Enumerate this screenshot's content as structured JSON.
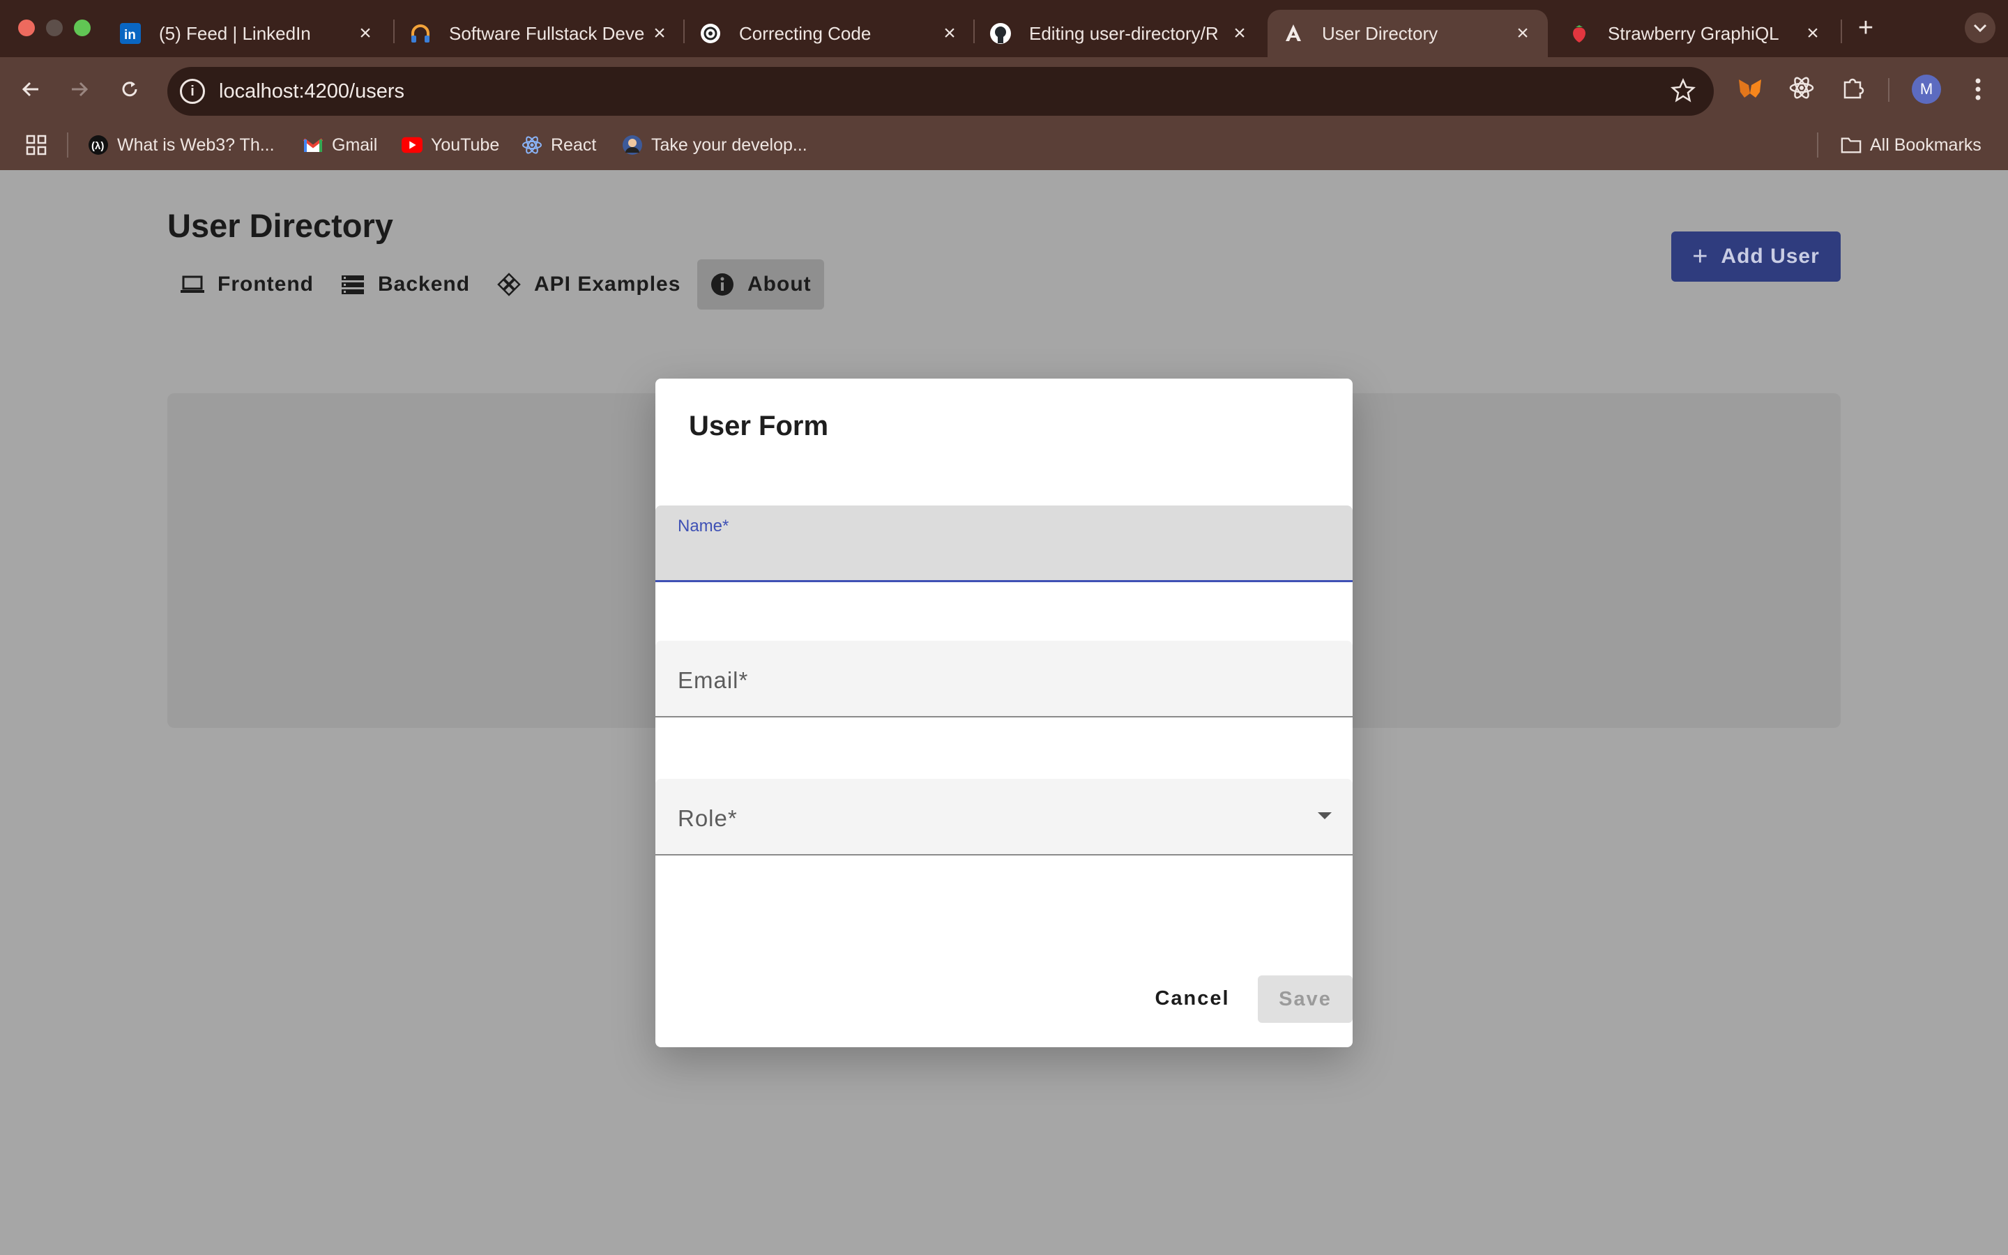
{
  "browser": {
    "tabs": [
      {
        "title": "(5) Feed | LinkedIn",
        "icon": "linkedin-icon"
      },
      {
        "title": "Software Fullstack Deve",
        "icon": "headphones-icon"
      },
      {
        "title": "Correcting Code",
        "icon": "openai-icon"
      },
      {
        "title": "Editing user-directory/R",
        "icon": "github-icon"
      },
      {
        "title": "User Directory",
        "icon": "angular-icon",
        "active": true
      },
      {
        "title": "Strawberry GraphiQL",
        "icon": "strawberry-icon"
      }
    ],
    "new_tab": "+",
    "url": "localhost:4200/users",
    "avatar_letter": "M",
    "bookmarks": [
      {
        "label": "What is Web3? Th...",
        "icon": "web3-icon"
      },
      {
        "label": "Gmail",
        "icon": "gmail-icon"
      },
      {
        "label": "YouTube",
        "icon": "youtube-icon"
      },
      {
        "label": "React",
        "icon": "react-icon"
      },
      {
        "label": "Take your develop...",
        "icon": "profile-icon"
      }
    ],
    "all_bookmarks": "All Bookmarks",
    "colors": {
      "tabstrip": "#3a221c",
      "toolbar": "#5a3f37"
    }
  },
  "page": {
    "title": "User Directory",
    "nav": [
      {
        "label": "Frontend",
        "icon": "laptop-icon"
      },
      {
        "label": "Backend",
        "icon": "storage-icon"
      },
      {
        "label": "API Examples",
        "icon": "api-icon"
      },
      {
        "label": "About",
        "icon": "info-icon",
        "active": true
      }
    ],
    "add_user_label": "Add User",
    "accent": "#3f51b5"
  },
  "dialog": {
    "title": "User Form",
    "fields": {
      "name": {
        "label": "Name*",
        "value": ""
      },
      "email": {
        "label": "Email*",
        "value": ""
      },
      "role": {
        "label": "Role*",
        "value": ""
      }
    },
    "cancel_label": "Cancel",
    "save_label": "Save"
  }
}
